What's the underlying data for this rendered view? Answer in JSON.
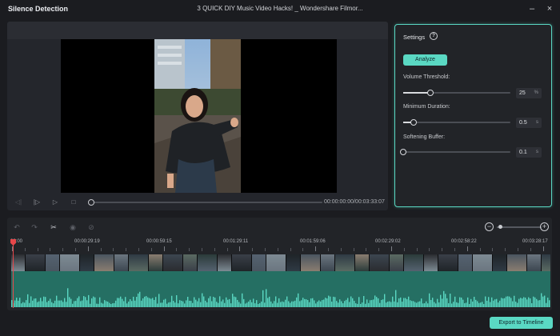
{
  "window": {
    "app_title": "Silence Detection",
    "doc_title": "3 QUICK DIY Music Video Hacks! _ Wondershare Filmor...",
    "close_glyph": "×",
    "minimize_glyph": "–"
  },
  "player": {
    "timecode": "00:00:00:00/00:03:33:07",
    "progress": 0,
    "controls": [
      {
        "name": "prev-frame-icon",
        "glyph": "◁|",
        "dim": true
      },
      {
        "name": "play-from-start-icon",
        "glyph": "|▷",
        "dim": false
      },
      {
        "name": "play-icon",
        "glyph": "▷",
        "dim": false
      },
      {
        "name": "stop-icon",
        "glyph": "□",
        "dim": false
      }
    ]
  },
  "settings": {
    "title": "Settings",
    "help_glyph": "?",
    "analyze_label": "Analyze",
    "params": [
      {
        "label": "Volume Threshold:",
        "value": "25",
        "unit": "%",
        "fraction": 0.25
      },
      {
        "label": "Minimum Duration:",
        "value": "0.5",
        "unit": "s",
        "fraction": 0.1
      },
      {
        "label": "Softening Buffer:",
        "value": "0.1",
        "unit": "s",
        "fraction": 0.0
      }
    ]
  },
  "timeline": {
    "tools": [
      {
        "name": "undo-icon",
        "glyph": "↶",
        "active": false
      },
      {
        "name": "redo-icon",
        "glyph": "↷",
        "active": false
      },
      {
        "name": "cut-icon",
        "glyph": "✂",
        "active": true
      },
      {
        "name": "eye-icon",
        "glyph": "◉",
        "active": false
      },
      {
        "name": "eye-off-icon",
        "glyph": "⊘",
        "active": false
      }
    ],
    "zoom_out_glyph": "−",
    "zoom_in_glyph": "+",
    "zoom_level": 0.05,
    "ruler_labels": [
      "00:00",
      "00:00:29:19",
      "00:00:59:15",
      "00:01:29:11",
      "00:01:59:06",
      "00:02:29:02",
      "00:02:58:22",
      "00:03:28:17"
    ]
  },
  "footer": {
    "export_label": "Export to Timeline"
  },
  "colors": {
    "accent": "#5ad8c3",
    "playhead": "#e8474a",
    "waveform": "#5ad8c3"
  }
}
